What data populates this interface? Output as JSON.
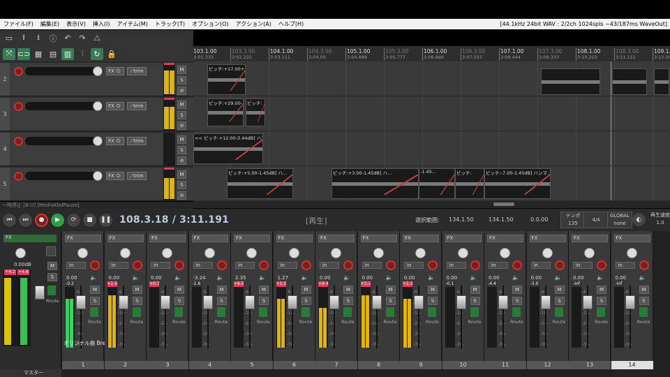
{
  "menu": [
    "ファイル(F)",
    "編集(E)",
    "表示(V)",
    "挿入(I)",
    "アイテム(M)",
    "トラック(T)",
    "オプション(O)",
    "アクション(A)",
    "ヘルプ(H)"
  ],
  "status_text": "[44.1kHz 24bit WAV : 2/2ch 1024spls ~43/187ms WaveOut]",
  "ruler": [
    {
      "bar": "103.1.00",
      "time": "3:01.333"
    },
    {
      "bar": "103.3.00",
      "time": "3:02.222",
      "minor": true
    },
    {
      "bar": "104.1.00",
      "time": "3:03.111"
    },
    {
      "bar": "104.3.00",
      "time": "3:04.00",
      "minor": true
    },
    {
      "bar": "105.1.00",
      "time": "3:04.888"
    },
    {
      "bar": "105.3.00",
      "time": "3:05.777",
      "minor": true
    },
    {
      "bar": "106.1.00",
      "time": "3:06.666"
    },
    {
      "bar": "106.3.00",
      "time": "3:07.555",
      "minor": true
    },
    {
      "bar": "107.1.00",
      "time": "3:08.444"
    },
    {
      "bar": "107.3.00",
      "time": "3:09.333",
      "minor": true
    },
    {
      "bar": "108.1.00",
      "time": "3:10.222"
    },
    {
      "bar": "108.3.00",
      "time": "3:11.111",
      "minor": true
    },
    {
      "bar": "109.1.00",
      "time": "3:12.000"
    }
  ],
  "tracks": [
    {
      "num": "2",
      "fx": "FX",
      "trim": "trim",
      "m": "M",
      "s": "S",
      "lvl": 0.85
    },
    {
      "num": "3",
      "fx": "FX",
      "trim": "trim",
      "m": "M",
      "s": "S",
      "lvl": 0.8
    },
    {
      "num": "4",
      "fx": "FX",
      "trim": "trim",
      "m": "M",
      "s": "S",
      "lvl": 0.0
    },
    {
      "num": "5",
      "fx": "FX",
      "trim": "trim",
      "m": "M",
      "s": "S",
      "lvl": 0.75
    }
  ],
  "items": {
    "i1": "ピッチ:+17.00+...",
    "i2": "ピッチ:+29.00-...",
    "i2b": "ピッチ:",
    "i3": "<< ピッチ:+12.00-3.44dB] ハン",
    "i4": "ピッチ:+5.00-1.45dB] ハ...",
    "i5": "ピッチ:+3.00-1.45dB] ハ...",
    "i6": "-1.45...",
    "i7": "ピッチ:",
    "i8": "ピッチ:-7.00-1.45dB] ハンマ..."
  },
  "statusline": "一時停止 [B:U] [MediaKbdPause]",
  "transport": {
    "position": "108.3.18 / 3:11.191",
    "state": "[再生]",
    "sel_label": "選択範囲:",
    "sel_start": "134.1.50",
    "sel_end": "134.1.50",
    "sel_len": "0.0.00",
    "tempo_label": "テンポ",
    "tempo": "135",
    "ts": "4/4",
    "global": "GLOBAL",
    "global_mode": "none",
    "rate_label": "再生速度",
    "rate": "1.0"
  },
  "master": {
    "fx": "FX",
    "vol": "0.00dB",
    "peak_l": "+4.2",
    "peak_r": "+4.8",
    "label": "マスター",
    "route": "Route",
    "m": "M",
    "s": "S"
  },
  "channels": [
    {
      "num": "1",
      "vol": "0.00",
      "peak": "-0.2",
      "lvl": 0.8,
      "color": "#39d26a",
      "name": "オリジナル曲 Bre"
    },
    {
      "num": "2",
      "vol": "0.00",
      "peak": "+1.6",
      "lvl": 0.85,
      "color": "#e3b400",
      "name": ""
    },
    {
      "num": "3",
      "vol": "0.00",
      "peak": "+0.7",
      "lvl": 0.0,
      "color": "#e3b400",
      "name": ""
    },
    {
      "num": "4",
      "vol": "-3.24",
      "peak": "-1.6",
      "lvl": 0.0,
      "color": "#e3b400",
      "name": ""
    },
    {
      "num": "5",
      "vol": "2.35",
      "peak": "+6.5",
      "lvl": 0.0,
      "color": "#e3b400",
      "name": ""
    },
    {
      "num": "6",
      "vol": "1.27",
      "peak": "+1.5",
      "lvl": 0.8,
      "color": "#e3b400",
      "name": ""
    },
    {
      "num": "7",
      "vol": "0.00",
      "peak": "+9.4",
      "lvl": 0.65,
      "color": "#e3b400",
      "name": ""
    },
    {
      "num": "8",
      "vol": "0.00",
      "peak": "+3.1",
      "lvl": 0.85,
      "color": "#e3b400",
      "name": ""
    },
    {
      "num": "9",
      "vol": "0.00",
      "peak": "+1.3",
      "lvl": 0.8,
      "color": "#e3b400",
      "name": ""
    },
    {
      "num": "10",
      "vol": "0.00",
      "peak": "-0.1",
      "lvl": 0.0,
      "color": "#e3b400",
      "name": ""
    },
    {
      "num": "11",
      "vol": "0.00",
      "peak": "-4.4",
      "lvl": 0.0,
      "color": "#e3b400",
      "name": ""
    },
    {
      "num": "12",
      "vol": "0.00",
      "peak": "-3.0",
      "lvl": 0.0,
      "color": "#e3b400",
      "name": ""
    },
    {
      "num": "13",
      "vol": "0.00",
      "peak": "-inf",
      "lvl": 0.0,
      "color": "#e3b400",
      "name": ""
    },
    {
      "num": "14",
      "vol": "0.00",
      "peak": "-inf",
      "lvl": 0.0,
      "color": "#e3b400",
      "name": ""
    }
  ],
  "labels": {
    "fx": "FX",
    "in": "in",
    "route": "Route",
    "m": "M",
    "s": "S"
  },
  "scale": [
    "-6-",
    "-12-",
    "-18-",
    "-24-",
    "-30-",
    "-36-"
  ]
}
